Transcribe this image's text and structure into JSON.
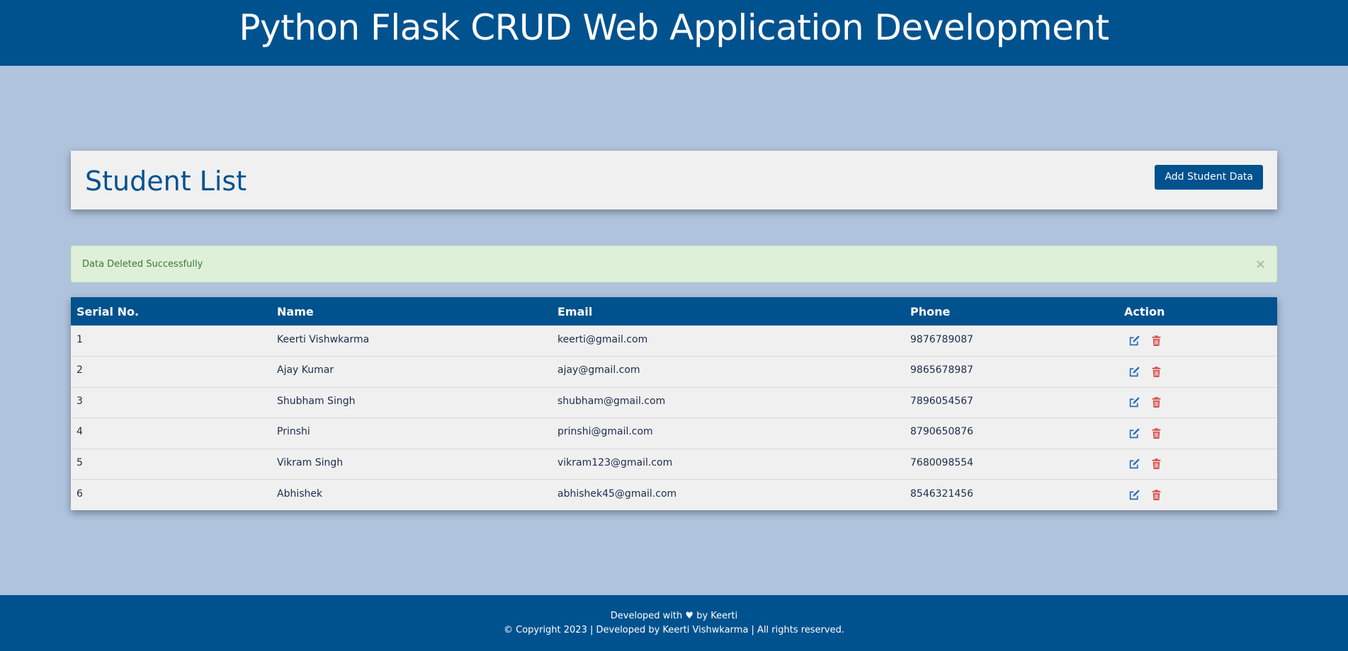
{
  "header": {
    "title": "Python Flask CRUD Web Application Development"
  },
  "page": {
    "title": "Student List",
    "add_button_label": "Add Student Data"
  },
  "alert": {
    "message": "Data Deleted Successfully",
    "close_label": "×"
  },
  "table": {
    "columns": [
      "Serial No.",
      "Name",
      "Email",
      "Phone",
      "Action"
    ],
    "rows": [
      {
        "serial": "1",
        "name": "Keerti Vishwkarma",
        "email": "keerti@gmail.com",
        "phone": "9876789087"
      },
      {
        "serial": "2",
        "name": "Ajay Kumar",
        "email": "ajay@gmail.com",
        "phone": "9865678987"
      },
      {
        "serial": "3",
        "name": "Shubham Singh",
        "email": "shubham@gmail.com",
        "phone": "7896054567"
      },
      {
        "serial": "4",
        "name": "Prinshi",
        "email": "prinshi@gmail.com",
        "phone": "8790650876"
      },
      {
        "serial": "5",
        "name": "Vikram Singh",
        "email": "vikram123@gmail.com",
        "phone": "7680098554"
      },
      {
        "serial": "6",
        "name": "Abhishek",
        "email": "abhishek45@gmail.com",
        "phone": "8546321456"
      }
    ],
    "action_icons": [
      "edit-icon",
      "delete-icon"
    ]
  },
  "footer": {
    "line1_prefix": "Developed with",
    "line1_heart": "♥",
    "line1_suffix": "by Keerti",
    "line2": "© Copyright 2023 | Developed by Keerti Vishwkarma | All rights reserved."
  },
  "colors": {
    "primary": "#00528f",
    "background": "#afc3dd",
    "card": "#f0f0f0",
    "alert_bg": "#def0d8",
    "alert_text": "#3c763d",
    "edit_icon": "#2a6db5",
    "delete_icon": "#d9534f"
  }
}
